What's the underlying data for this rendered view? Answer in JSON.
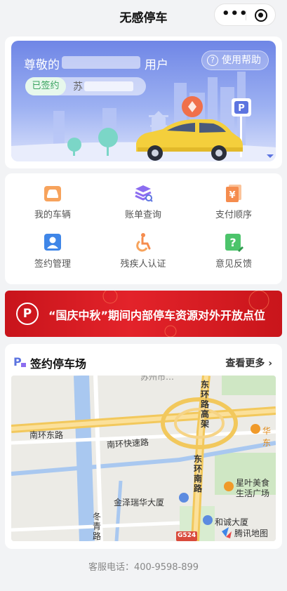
{
  "header": {
    "title": "无感停车"
  },
  "banner": {
    "greeting": "尊敬的",
    "user_suffix": "用户",
    "help_label": "使用帮助",
    "signed_label": "已签约",
    "plate_prefix": "苏"
  },
  "menu": {
    "items": [
      {
        "label": "我的车辆",
        "icon": "car-icon"
      },
      {
        "label": "账单查询",
        "icon": "bill-search-icon"
      },
      {
        "label": "支付顺序",
        "icon": "payment-order-icon"
      },
      {
        "label": "签约管理",
        "icon": "contract-icon"
      },
      {
        "label": "残疾人认证",
        "icon": "wheelchair-icon"
      },
      {
        "label": "意见反馈",
        "icon": "feedback-icon"
      }
    ]
  },
  "promo": {
    "text": "“国庆中秋”期间内部停车资源对外开放点位"
  },
  "parking": {
    "title": "签约停车场",
    "more_label": "查看更多",
    "map": {
      "labels": {
        "nanhuan_expressway": "南环快速路",
        "nanhuan_east": "南环东路",
        "donghuan_elevated": "东环路高架",
        "donghuan_south": "东环南路",
        "dongqing": "冬青路",
        "jinze": "金泽瑞华大厦",
        "hecheng": "和诚大厦",
        "xingye": "星叶美食生活广场",
        "huadong": "华东",
        "g524": "G524",
        "top_partial": "苏州市…",
        "provider": "腾讯地图"
      }
    }
  },
  "footer": {
    "hotline": "客服电话：400-9598-899"
  },
  "colors": {
    "accent": "#6f86e6",
    "promo_red": "#d91b22",
    "signed_green": "#3aa35f"
  }
}
